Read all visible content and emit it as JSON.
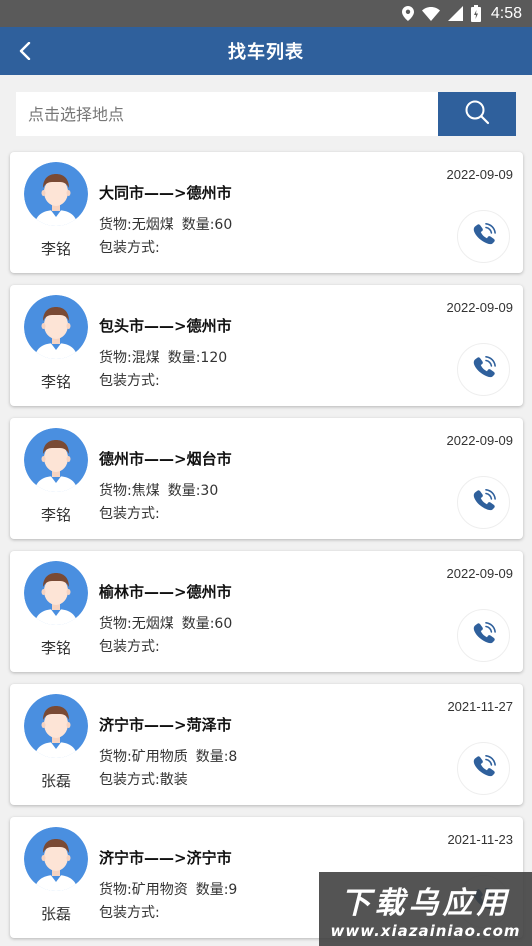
{
  "status_bar": {
    "time": "4:58",
    "icons": [
      "location-icon",
      "wifi-icon",
      "signal-icon",
      "battery-icon"
    ]
  },
  "header": {
    "title": "找车列表",
    "back_icon": "chevron-left-icon"
  },
  "search": {
    "placeholder": "点击选择地点",
    "value": "",
    "icon": "search-icon"
  },
  "colors": {
    "primary": "#2f609c",
    "background": "#f1f1f1",
    "avatar_bg": "#4a8fe0"
  },
  "items": [
    {
      "name": "李铭",
      "route": "大同市——>德州市",
      "cargo": "货物:无烟煤",
      "quantity": "数量:60",
      "packaging": "包装方式:",
      "date": "2022-09-09"
    },
    {
      "name": "李铭",
      "route": "包头市——>德州市",
      "cargo": "货物:混煤",
      "quantity": "数量:120",
      "packaging": "包装方式:",
      "date": "2022-09-09"
    },
    {
      "name": "李铭",
      "route": "德州市——>烟台市",
      "cargo": "货物:焦煤",
      "quantity": "数量:30",
      "packaging": "包装方式:",
      "date": "2022-09-09"
    },
    {
      "name": "李铭",
      "route": "榆林市——>德州市",
      "cargo": "货物:无烟煤",
      "quantity": "数量:60",
      "packaging": "包装方式:",
      "date": "2022-09-09"
    },
    {
      "name": "张磊",
      "route": "济宁市——>菏泽市",
      "cargo": "货物:矿用物质",
      "quantity": "数量:8",
      "packaging": "包装方式:散装",
      "date": "2021-11-27"
    },
    {
      "name": "张磊",
      "route": "济宁市——>济宁市",
      "cargo": "货物:矿用物资",
      "quantity": "数量:9",
      "packaging": "包装方式:",
      "date": "2021-11-23"
    }
  ],
  "watermark": {
    "title": "下载乌应用",
    "url": "www.xiazainiao.com"
  }
}
